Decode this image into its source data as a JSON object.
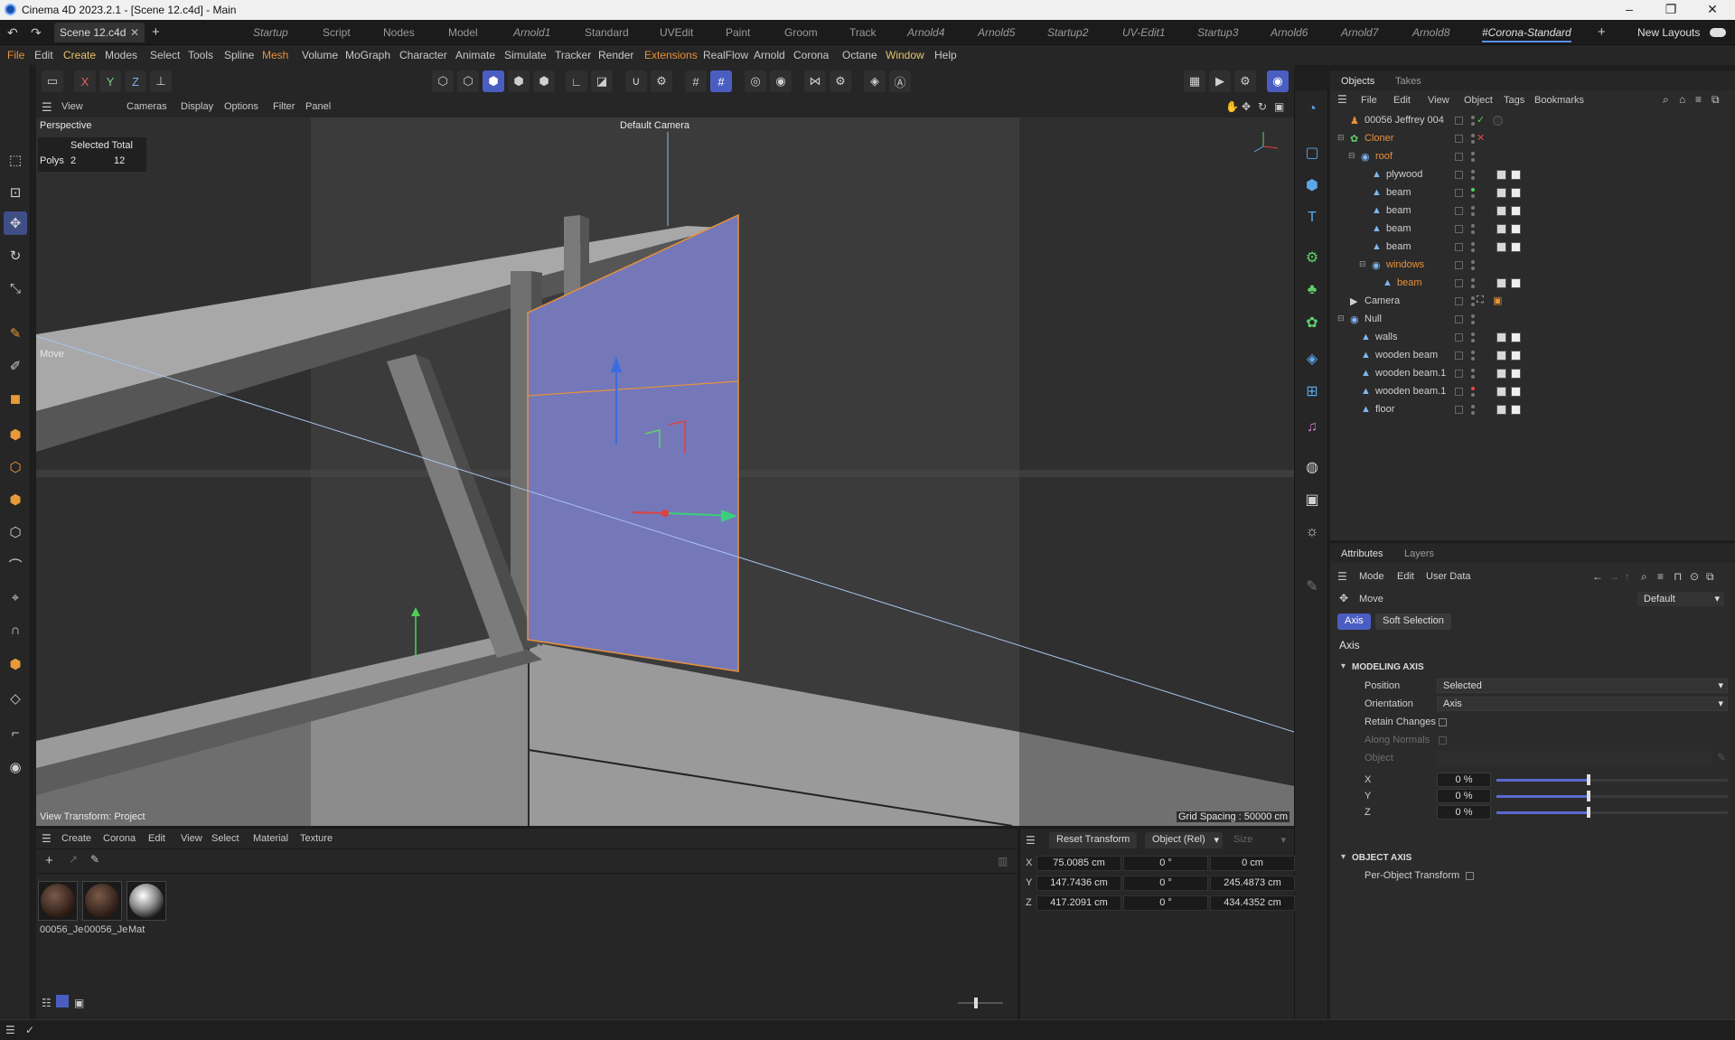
{
  "window": {
    "title": "Cinema 4D 2023.2.1 - [Scene 12.c4d] - Main",
    "controls": [
      "–",
      "❐",
      "✕"
    ]
  },
  "document_tab": "Scene 12.c4d",
  "layouts": [
    {
      "label": "Startup",
      "italic": true
    },
    {
      "label": "Script",
      "italic": false
    },
    {
      "label": "Nodes",
      "italic": false
    },
    {
      "label": "Model",
      "italic": false
    },
    {
      "label": "Arnold1",
      "italic": true
    },
    {
      "label": "Standard",
      "italic": false
    },
    {
      "label": "UVEdit",
      "italic": false
    },
    {
      "label": "Paint",
      "italic": false
    },
    {
      "label": "Groom",
      "italic": false
    },
    {
      "label": "Track",
      "italic": false
    },
    {
      "label": "Arnold4",
      "italic": true
    },
    {
      "label": "Arnold5",
      "italic": true
    },
    {
      "label": "Startup2",
      "italic": true
    },
    {
      "label": "UV-Edit1",
      "italic": true
    },
    {
      "label": "Startup3",
      "italic": true
    },
    {
      "label": "Arnold6",
      "italic": true
    },
    {
      "label": "Arnold7",
      "italic": true
    },
    {
      "label": "Arnold8",
      "italic": true
    },
    {
      "label": "#Corona-Standard",
      "italic": true,
      "active": true
    }
  ],
  "new_layouts": "New Layouts",
  "menu": [
    "File",
    "Edit",
    "Create",
    "Modes",
    "Select",
    "Tools",
    "Spline",
    "Mesh",
    "Volume",
    "MoGraph",
    "Character",
    "Animate",
    "Simulate",
    "Tracker",
    "Render",
    "Extensions",
    "RealFlow",
    "Arnold",
    "Corona",
    "Octane",
    "Window",
    "Help"
  ],
  "axis_lock": [
    "X",
    "Y",
    "Z"
  ],
  "viewport_menu": [
    "View",
    "Cameras",
    "Display",
    "Options",
    "Filter",
    "Panel"
  ],
  "viewport": {
    "name": "Perspective",
    "camera": "Default Camera",
    "stats_header": "Selected Total",
    "stats_label": "Polys",
    "stats_selected": "2",
    "stats_total": "12",
    "tool_label": "Move",
    "view_transform": "View Transform: Project",
    "grid_spacing": "Grid Spacing : 50000 cm"
  },
  "objects_panel": {
    "tabs": [
      "Objects",
      "Takes"
    ],
    "menu": [
      "File",
      "Edit",
      "View",
      "Object",
      "Tags",
      "Bookmarks"
    ],
    "rows": [
      {
        "name": "00056 Jeffrey 004",
        "indent": 0,
        "orange": false,
        "icon": "figure"
      },
      {
        "name": "Cloner",
        "indent": 0,
        "orange": true,
        "icon": "cloner"
      },
      {
        "name": "roof",
        "indent": 1,
        "orange": true,
        "icon": "null"
      },
      {
        "name": "plywood",
        "indent": 2,
        "orange": false,
        "icon": "poly"
      },
      {
        "name": "beam",
        "indent": 2,
        "orange": false,
        "icon": "poly"
      },
      {
        "name": "beam",
        "indent": 2,
        "orange": false,
        "icon": "poly"
      },
      {
        "name": "beam",
        "indent": 2,
        "orange": false,
        "icon": "poly"
      },
      {
        "name": "beam",
        "indent": 2,
        "orange": false,
        "icon": "poly"
      },
      {
        "name": "windows",
        "indent": 2,
        "orange": true,
        "icon": "null"
      },
      {
        "name": "beam",
        "indent": 3,
        "orange": true,
        "icon": "poly"
      },
      {
        "name": "Camera",
        "indent": 0,
        "orange": false,
        "icon": "camera"
      },
      {
        "name": "Null",
        "indent": 0,
        "orange": false,
        "icon": "null"
      },
      {
        "name": "walls",
        "indent": 1,
        "orange": false,
        "icon": "poly"
      },
      {
        "name": "wooden beam",
        "indent": 1,
        "orange": false,
        "icon": "poly"
      },
      {
        "name": "wooden beam.1",
        "indent": 1,
        "orange": false,
        "icon": "poly"
      },
      {
        "name": "wooden beam.1",
        "indent": 1,
        "orange": false,
        "icon": "poly"
      },
      {
        "name": "floor",
        "indent": 1,
        "orange": false,
        "icon": "poly"
      }
    ]
  },
  "attributes_panel": {
    "tabs": [
      "Attributes",
      "Layers"
    ],
    "menu": [
      "Mode",
      "Edit",
      "User Data"
    ],
    "tool": "Move",
    "preset": "Default",
    "subtabs": [
      "Axis",
      "Soft Selection"
    ],
    "section_title": "Axis",
    "modeling_axis": "MODELING AXIS",
    "position_label": "Position",
    "position_value": "Selected",
    "orientation_label": "Orientation",
    "orientation_value": "Axis",
    "retain_changes": "Retain Changes",
    "along_normals": "Along Normals",
    "object_label": "Object",
    "axes": [
      {
        "label": "X",
        "value": "0 %",
        "level": 0.0
      },
      {
        "label": "Y",
        "value": "0 %",
        "level": 0.0
      },
      {
        "label": "Z",
        "value": "0 %",
        "level": 0.0
      }
    ],
    "object_axis": "OBJECT AXIS",
    "per_object_transform": "Per-Object Transform"
  },
  "material_panel": {
    "menu": [
      "Create",
      "Corona",
      "Edit",
      "View",
      "Select",
      "Material",
      "Texture"
    ],
    "materials": [
      "00056_Je",
      "00056_Je",
      "Mat"
    ]
  },
  "coordinates_panel": {
    "reset_transform": "Reset Transform",
    "mode": "Object (Rel)",
    "size_mode": "Size",
    "rows": [
      {
        "axis": "X",
        "position": "75.0085 cm",
        "rotation": "0 °",
        "size": "0 cm"
      },
      {
        "axis": "Y",
        "position": "147.7436 cm",
        "rotation": "0 °",
        "size": "245.4873 cm"
      },
      {
        "axis": "Z",
        "position": "417.2091 cm",
        "rotation": "0 °",
        "size": "434.4352 cm"
      }
    ]
  },
  "colors": {
    "accent_blue": "#4a5ec2",
    "selection_orange": "#e8913a",
    "polygon_fill": "#7478b8"
  }
}
